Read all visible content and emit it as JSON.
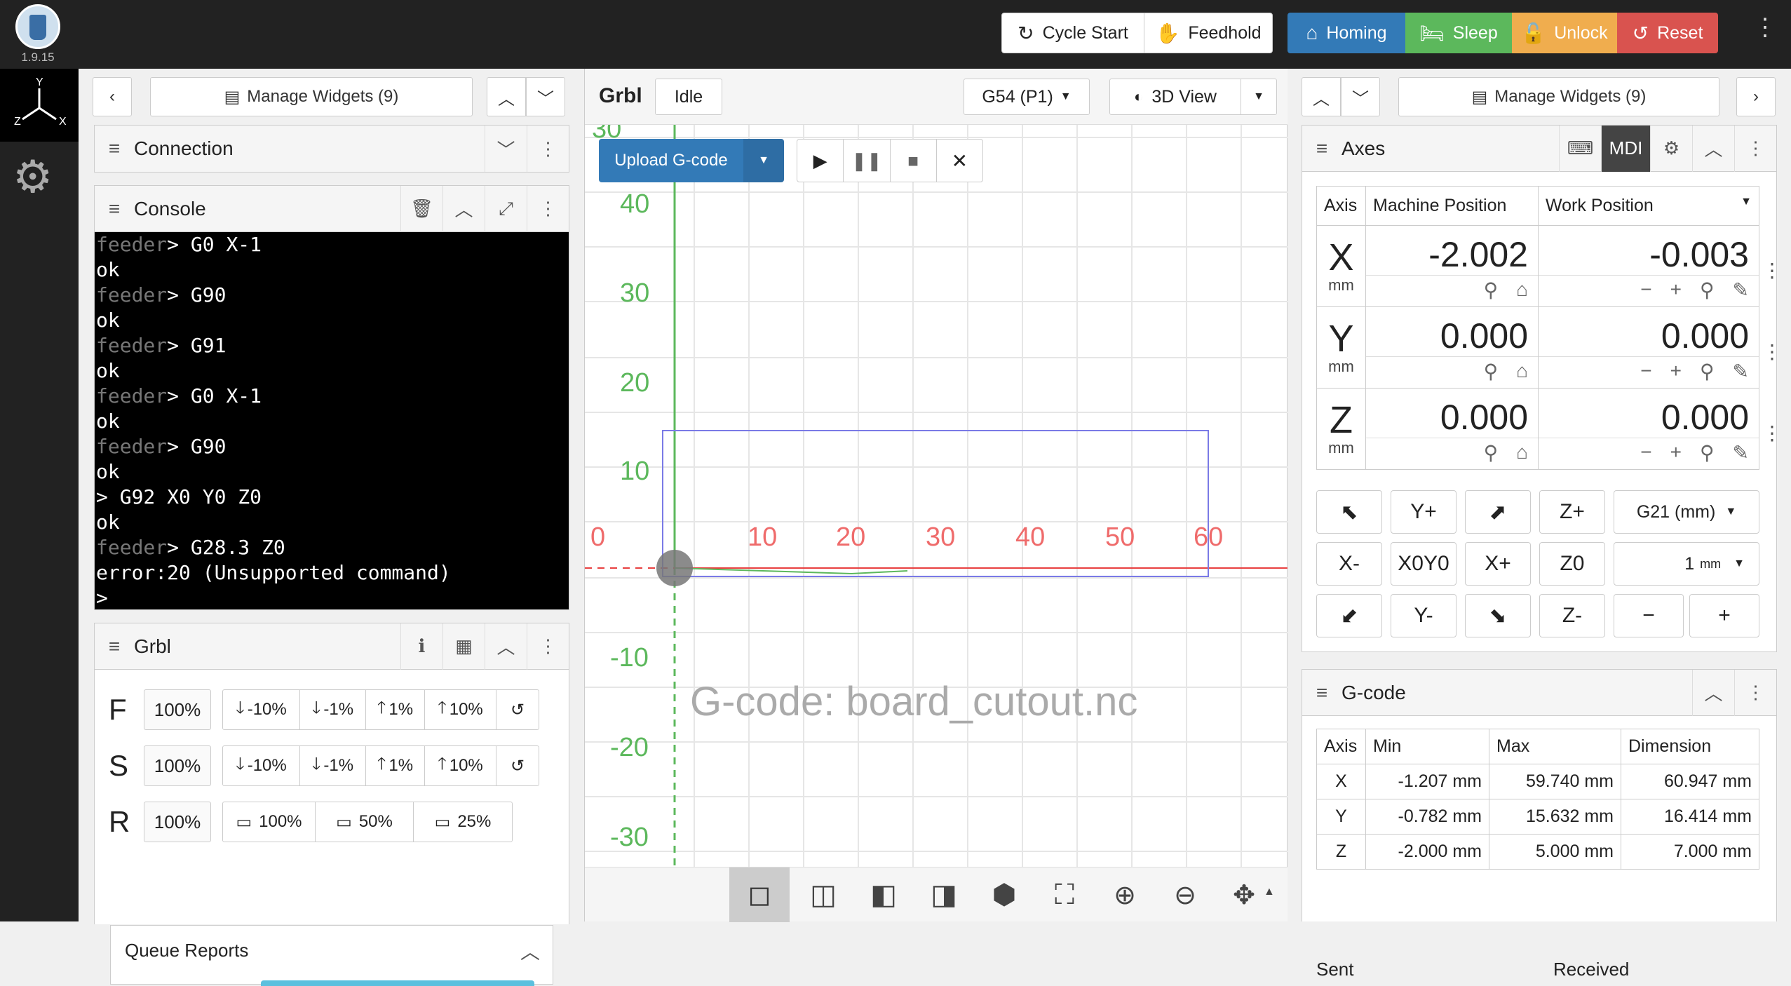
{
  "app": {
    "version": "1.9.15"
  },
  "toolbar": {
    "cycle_start": "Cycle Start",
    "feedhold": "Feedhold",
    "homing": "Homing",
    "sleep": "Sleep",
    "unlock": "Unlock",
    "reset": "Reset",
    "colors": {
      "homing": "#337ab7",
      "sleep": "#5cb85c",
      "unlock": "#f0ad4e",
      "reset": "#d9534f"
    }
  },
  "left": {
    "manage_widgets": "Manage Widgets (9)",
    "connection": {
      "title": "Connection"
    },
    "console": {
      "title": "Console",
      "lines": [
        {
          "prefix": "feeder",
          "text": "> G0 X-1"
        },
        {
          "prefix": "",
          "text": "ok"
        },
        {
          "prefix": "feeder",
          "text": "> G90"
        },
        {
          "prefix": "",
          "text": "ok"
        },
        {
          "prefix": "feeder",
          "text": "> G91"
        },
        {
          "prefix": "",
          "text": "ok"
        },
        {
          "prefix": "feeder",
          "text": "> G0 X-1"
        },
        {
          "prefix": "",
          "text": "ok"
        },
        {
          "prefix": "feeder",
          "text": "> G90"
        },
        {
          "prefix": "",
          "text": "ok"
        },
        {
          "prefix": "",
          "text": "> G92 X0 Y0 Z0"
        },
        {
          "prefix": "",
          "text": "ok"
        },
        {
          "prefix": "feeder",
          "text": "> G28.3 Z0"
        },
        {
          "prefix": "",
          "text": "error:20 (Unsupported command)"
        },
        {
          "prefix": "",
          "text": ">"
        }
      ]
    },
    "grbl": {
      "title": "Grbl",
      "F": {
        "label": "F",
        "value": "100%",
        "b1": "-10%",
        "b2": "-1%",
        "b3": "1%",
        "b4": "10%"
      },
      "S": {
        "label": "S",
        "value": "100%",
        "b1": "-10%",
        "b2": "-1%",
        "b3": "1%",
        "b4": "10%"
      },
      "R": {
        "label": "R",
        "value": "100%",
        "b1": "100%",
        "b2": "50%",
        "b3": "25%"
      },
      "queue_reports": "Queue Reports"
    }
  },
  "mid": {
    "title": "Grbl",
    "state": "Idle",
    "wcs": "G54 (P1)",
    "view": "3D View",
    "upload": "Upload G-code",
    "gcode_label": "G-code: board_cutout.nc",
    "x_ticks": [
      "0",
      "10",
      "20",
      "30",
      "40",
      "50",
      "60"
    ],
    "y_ticks": [
      "40",
      "30",
      "20",
      "10",
      "-10",
      "-20",
      "-30"
    ]
  },
  "right": {
    "manage_widgets": "Manage Widgets (9)",
    "axes": {
      "title": "Axes",
      "mdi": "MDI",
      "col_axis": "Axis",
      "col_machine": "Machine Position",
      "col_work": "Work Position",
      "rows": [
        {
          "axis": "X",
          "unit": "mm",
          "machine": "-2.002",
          "work": "-0.003"
        },
        {
          "axis": "Y",
          "unit": "mm",
          "machine": "0.000",
          "work": "0.000"
        },
        {
          "axis": "Z",
          "unit": "mm",
          "machine": "0.000",
          "work": "0.000"
        }
      ],
      "jog": {
        "yplus": "Y+",
        "zplus": "Z+",
        "units": "G21 (mm)",
        "xminus": "X-",
        "x0y0": "X0Y0",
        "xplus": "X+",
        "z0": "Z0",
        "step": "1",
        "step_unit": "mm",
        "yminus": "Y-",
        "zminus": "Z-",
        "minus": "−",
        "plus": "+"
      }
    },
    "gcode": {
      "title": "G-code",
      "headers": [
        "Axis",
        "Min",
        "Max",
        "Dimension"
      ],
      "rows": [
        [
          "X",
          "-1.207 mm",
          "59.740 mm",
          "60.947 mm"
        ],
        [
          "Y",
          "-0.782 mm",
          "15.632 mm",
          "16.414 mm"
        ],
        [
          "Z",
          "-2.000 mm",
          "5.000 mm",
          "7.000 mm"
        ]
      ],
      "sent": "Sent",
      "received": "Received"
    }
  }
}
